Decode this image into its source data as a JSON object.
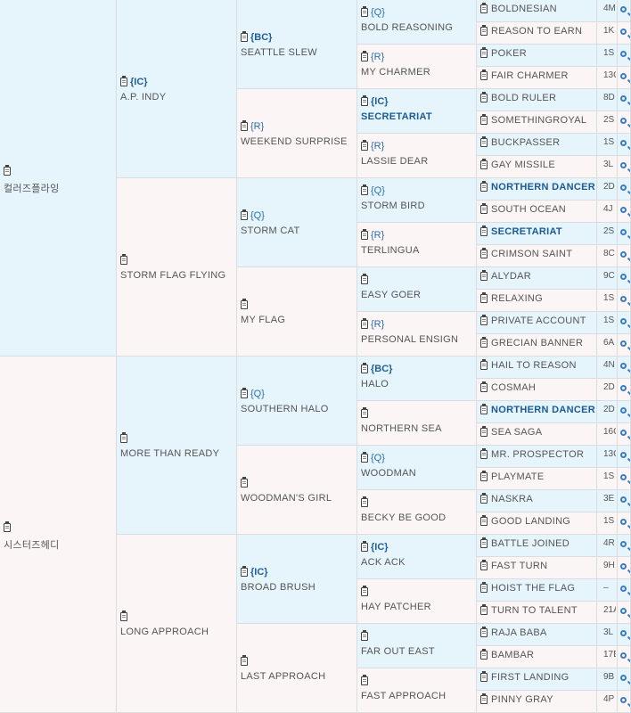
{
  "pedigree": {
    "gen1": [
      {
        "name": "컬러즈플라잉",
        "tag": ""
      },
      {
        "name": "시스터즈헤디",
        "tag": ""
      }
    ],
    "gen2": [
      {
        "name": "A.P. INDY",
        "tag": "{IC}"
      },
      {
        "name": "STORM FLAG FLYING",
        "tag": ""
      },
      {
        "name": "MORE THAN READY",
        "tag": ""
      },
      {
        "name": "LONG APPROACH",
        "tag": ""
      }
    ],
    "gen3": [
      {
        "name": "SEATTLE SLEW",
        "tag": "{BC}"
      },
      {
        "name": "WEEKEND SURPRISE",
        "tag": "{R}"
      },
      {
        "name": "STORM CAT",
        "tag": "{Q}"
      },
      {
        "name": "MY FLAG",
        "tag": ""
      },
      {
        "name": "SOUTHERN HALO",
        "tag": "{Q}"
      },
      {
        "name": "WOODMAN'S GIRL",
        "tag": ""
      },
      {
        "name": "BROAD BRUSH",
        "tag": "{IC}"
      },
      {
        "name": "LAST APPROACH",
        "tag": ""
      }
    ],
    "gen4": [
      {
        "name": "BOLD REASONING",
        "tag": "{Q}"
      },
      {
        "name": "MY CHARMER",
        "tag": "{R}"
      },
      {
        "name": "SECRETARIAT",
        "tag": "{IC}"
      },
      {
        "name": "LASSIE DEAR",
        "tag": "{R}"
      },
      {
        "name": "STORM BIRD",
        "tag": "{Q}"
      },
      {
        "name": "TERLINGUA",
        "tag": "{R}"
      },
      {
        "name": "EASY GOER",
        "tag": ""
      },
      {
        "name": "PERSONAL ENSIGN",
        "tag": "{R}"
      },
      {
        "name": "HALO",
        "tag": "{BC}"
      },
      {
        "name": "NORTHERN SEA",
        "tag": ""
      },
      {
        "name": "WOODMAN",
        "tag": "{Q}"
      },
      {
        "name": "BECKY BE GOOD",
        "tag": ""
      },
      {
        "name": "ACK ACK",
        "tag": "{IC}"
      },
      {
        "name": "HAY PATCHER",
        "tag": ""
      },
      {
        "name": "FAR OUT EAST",
        "tag": ""
      },
      {
        "name": "FAST APPROACH",
        "tag": ""
      }
    ],
    "gen5": [
      {
        "name": "BOLDNESIAN",
        "code": "4M"
      },
      {
        "name": "REASON TO EARN",
        "code": "1K"
      },
      {
        "name": "POKER",
        "code": "1S"
      },
      {
        "name": "FAIR CHARMER",
        "code": "13C"
      },
      {
        "name": "BOLD RULER",
        "code": "8D"
      },
      {
        "name": "SOMETHINGROYAL",
        "code": "2S"
      },
      {
        "name": "BUCKPASSER",
        "code": "1S"
      },
      {
        "name": "GAY MISSILE",
        "code": "3L"
      },
      {
        "name": "NORTHERN DANCER",
        "code": "2D"
      },
      {
        "name": "SOUTH OCEAN",
        "code": "4J"
      },
      {
        "name": "SECRETARIAT",
        "code": "2S"
      },
      {
        "name": "CRIMSON SAINT",
        "code": "8C"
      },
      {
        "name": "ALYDAR",
        "code": "9C"
      },
      {
        "name": "RELAXING",
        "code": "1S"
      },
      {
        "name": "PRIVATE ACCOUNT",
        "code": "1S"
      },
      {
        "name": "GRECIAN BANNER",
        "code": "6A"
      },
      {
        "name": "HAIL TO REASON",
        "code": "4N"
      },
      {
        "name": "COSMAH",
        "code": "2D"
      },
      {
        "name": "NORTHERN DANCER",
        "code": "2D"
      },
      {
        "name": "SEA SAGA",
        "code": "16C"
      },
      {
        "name": "MR. PROSPECTOR",
        "code": "13C"
      },
      {
        "name": "PLAYMATE",
        "code": "1S"
      },
      {
        "name": "NASKRA",
        "code": "3E"
      },
      {
        "name": "GOOD LANDING",
        "code": "1S"
      },
      {
        "name": "BATTLE JOINED",
        "code": "4R"
      },
      {
        "name": "FAST TURN",
        "code": "9H"
      },
      {
        "name": "HOIST THE FLAG",
        "code": "–"
      },
      {
        "name": "TURN TO TALENT",
        "code": "21A"
      },
      {
        "name": "RAJA BABA",
        "code": "3L"
      },
      {
        "name": "BAMBAR",
        "code": "17B"
      },
      {
        "name": "FIRST LANDING",
        "code": "9B"
      },
      {
        "name": "PINNY GRAY",
        "code": "4P"
      }
    ]
  }
}
